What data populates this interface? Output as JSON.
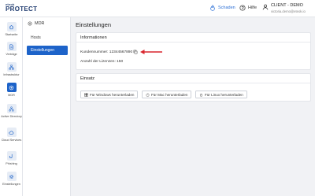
{
  "header": {
    "logo_top": "eteok",
    "logo_main": "PROTECT",
    "schaden_label": "Schaden",
    "hilfe_label": "Hilfe",
    "user_name": "CLIENT - DEMO",
    "user_email": "victoria.demo@eteok.io"
  },
  "rail": {
    "items": [
      {
        "label": "Startseite",
        "icon": "home-icon"
      },
      {
        "label": "Verträge",
        "icon": "document-icon"
      },
      {
        "label": "Infrastruktur",
        "icon": "network-icon"
      },
      {
        "label": "MDR",
        "icon": "shield-icon"
      },
      {
        "label": "Active Directory",
        "icon": "tree-icon"
      },
      {
        "label": "Cloud Services",
        "icon": "cloud-icon"
      },
      {
        "label": "Phishing",
        "icon": "hook-icon"
      },
      {
        "label": "Einstellungen",
        "icon": "gear-icon"
      }
    ]
  },
  "subnav": {
    "title": "MDR",
    "items": [
      {
        "label": "Hosts"
      },
      {
        "label": "Einstellungen"
      }
    ]
  },
  "main": {
    "title": "Einstellungen",
    "info": {
      "heading": "Informationen",
      "customer_number": "Kundennummer: 12344567890",
      "license_count": "Anzahl der Lizenzen: 150"
    },
    "einsatz": {
      "heading": "Einsatz",
      "buttons": [
        {
          "label": "Für Windows herunterladen",
          "icon": "windows-icon"
        },
        {
          "label": "Für Mac herunterladen",
          "icon": "apple-icon"
        },
        {
          "label": "Für Linux herunterladen",
          "icon": "linux-icon"
        }
      ]
    }
  },
  "colors": {
    "accent": "#1d63c9",
    "arrow": "#d9252d",
    "logo": "#1e3a6e"
  }
}
